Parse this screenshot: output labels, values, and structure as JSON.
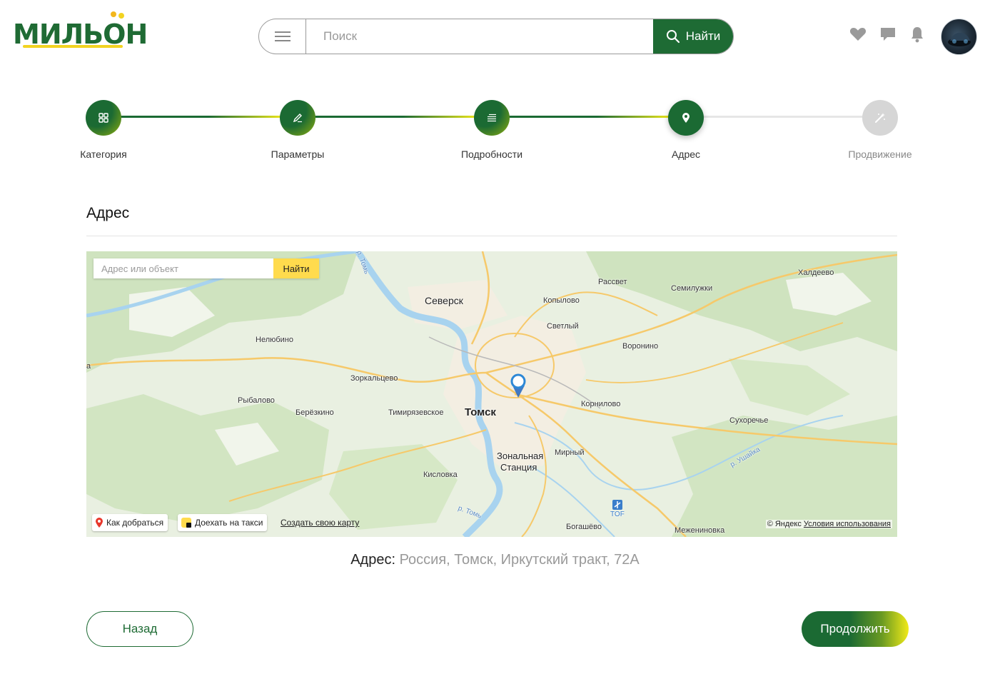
{
  "header": {
    "logo_text": "МИЛЬОН",
    "search": {
      "placeholder": "Поиск",
      "button_label": "Найти"
    },
    "icons": [
      "menu-icon",
      "search-icon",
      "heart-icon",
      "chat-icon",
      "bell-icon"
    ]
  },
  "stepper": {
    "steps": [
      {
        "label": "Категория",
        "state": "done",
        "icon": "grid-icon"
      },
      {
        "label": "Параметры",
        "state": "done",
        "icon": "pencil-icon"
      },
      {
        "label": "Подробности",
        "state": "done",
        "icon": "lines-icon"
      },
      {
        "label": "Адрес",
        "state": "active",
        "icon": "pin-icon"
      },
      {
        "label": "Продвижение",
        "state": "todo",
        "icon": "magic-wand-icon"
      }
    ]
  },
  "section": {
    "title": "Адрес"
  },
  "map": {
    "search_placeholder": "Адрес или объект",
    "search_button": "Найти",
    "route_button": "Как добраться",
    "taxi_button": "Доехать на такси",
    "create_map_link": "Создать свою карту",
    "copyright": "© Яндекс",
    "terms_link": "Условия использования",
    "places": {
      "seversk": "Северск",
      "tomsk": "Томск",
      "zonalnaya": "Зональная",
      "stantsiya": "Станция",
      "kopylovo": "Копылово",
      "rasvet": "Рассвет",
      "semiluzhki": "Семилужки",
      "khaldeevo": "Халдеево",
      "svetly": "Светлый",
      "voronino": "Воронино",
      "nelyubino": "Нелюбино",
      "zorkaltsevo": "Зоркальцево",
      "rybalovo": "Рыбалово",
      "berezkino": "Берёзкино",
      "timiryazevskoe": "Тимирязевское",
      "kornilovo": "Корнилово",
      "sukhorechye": "Сухоречье",
      "mirny": "Мирный",
      "kislovka": "Кисловка",
      "bogashevo": "Богашёво",
      "mezheninovka": "Межениновка",
      "tof": "TOF",
      "river_tom_1": "р. Томь",
      "river_tom_2": "р. Томь",
      "river_ushayka": "р. Ушайка",
      "edge_a": "а"
    }
  },
  "address": {
    "label": "Адрес:",
    "value": "Россия, Томск, Иркутский тракт, 72А"
  },
  "footer": {
    "back_label": "Назад",
    "next_label": "Продолжить"
  },
  "colors": {
    "brand_green": "#1e6b34",
    "accent_yellow": "#f0ea18",
    "map_button_yellow": "#ffdb4d"
  }
}
